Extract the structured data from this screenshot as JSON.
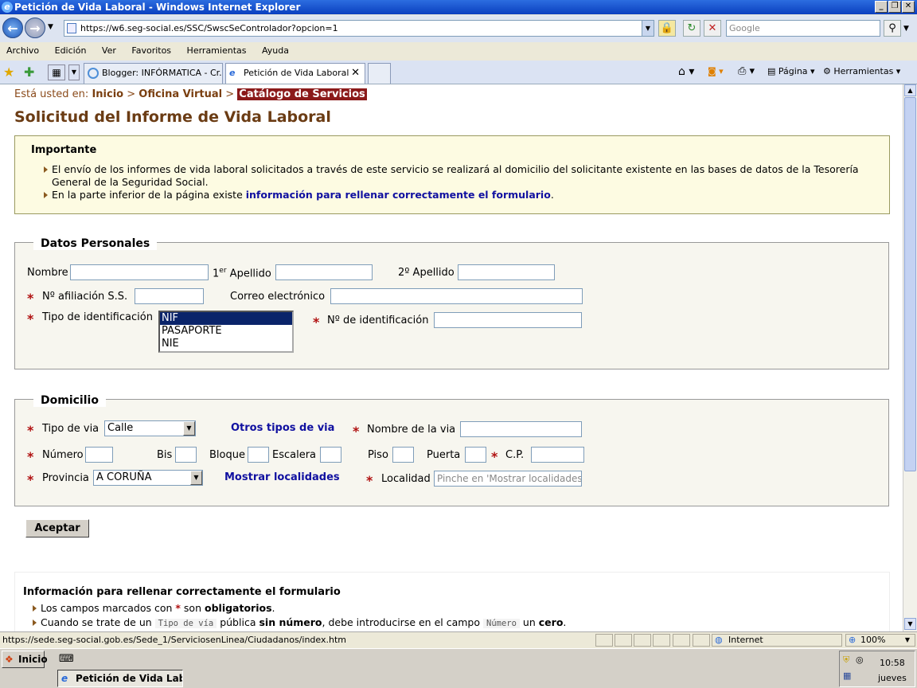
{
  "window": {
    "title": "Petición de Vida Laboral - Windows Internet Explorer"
  },
  "address": {
    "url": "https://w6.seg-social.es/SSC/SwscSeControlador?opcion=1",
    "search_placeholder": "Google"
  },
  "menu": [
    "Archivo",
    "Edición",
    "Ver",
    "Favoritos",
    "Herramientas",
    "Ayuda"
  ],
  "tabs": [
    {
      "label": "Blogger: INFÓRMATICA - Cr..."
    },
    {
      "label": "Petición de Vida Laboral"
    }
  ],
  "commandbar": {
    "pagina": "Página",
    "herramientas": "Herramientas"
  },
  "breadcrumb": {
    "prefix": "Está usted en:",
    "items": [
      "Inicio",
      "Oficina Virtual",
      "Catálogo de Servicios"
    ],
    "sep": ">"
  },
  "page_title": "Solicitud del Informe de Vida Laboral",
  "important": {
    "title": "Importante",
    "bullet1": "El envío de los informes de vida laboral solicitados a través de este servicio se realizará al domicilio del solicitante existente en las bases de datos de la Tesorería General de la Seguridad Social.",
    "bullet2_pre": "En la parte inferior de la página existe",
    "bullet2_link": "información para rellenar correctamente el formulario",
    "bullet2_post": "."
  },
  "personal": {
    "legend": "Datos Personales",
    "nombre": "Nombre",
    "apellido1_sup": "er",
    "apellido1_num": "1",
    "apellido1": "Apellido",
    "apellido2_num": "2º",
    "apellido2": "Apellido",
    "afiliacion": "Nº afiliación S.S.",
    "correo": "Correo electrónico",
    "tipo_id": "Tipo de identificación",
    "id_options": [
      "NIF",
      "PASAPORTE",
      "NIE"
    ],
    "num_id": "Nº de identificación"
  },
  "domicilio": {
    "legend": "Domicilio",
    "tipo_via": "Tipo de via",
    "tipo_via_value": "Calle",
    "otros_tipos": "Otros tipos de via",
    "nombre_via": "Nombre de la via",
    "numero": "Número",
    "bis": "Bis",
    "bloque": "Bloque",
    "escalera": "Escalera",
    "piso": "Piso",
    "puerta": "Puerta",
    "cp": "C.P.",
    "provincia": "Provincia",
    "provincia_value": "A CORUÑA",
    "mostrar_localidades": "Mostrar localidades",
    "localidad": "Localidad",
    "localidad_placeholder": "Pinche en 'Mostrar localidades'"
  },
  "submit": "Aceptar",
  "info": {
    "title": "Información para rellenar correctamente el formulario",
    "b1_pre": "Los campos marcados con",
    "b1_mid": "son",
    "b1_bold": "obligatorios",
    "b1_post": ".",
    "b2_pre": "Cuando se trate de un",
    "b2_code1": "Tipo de vía",
    "b2_mid1": "pública",
    "b2_bold1": "sin número",
    "b2_mid2": ", debe introducirse en el campo",
    "b2_code2": "Número",
    "b2_mid3": "un",
    "b2_bold2": "cero",
    "b2_post": "."
  },
  "status": {
    "url": "https://sede.seg-social.gob.es/Sede_1/ServiciosenLinea/Ciudadanos/index.htm",
    "zone": "Internet",
    "zoom": "100%"
  },
  "taskbar": {
    "start": "Inicio",
    "item": "Petición de Vida Labo...",
    "time": "10:58",
    "day": "jueves"
  }
}
